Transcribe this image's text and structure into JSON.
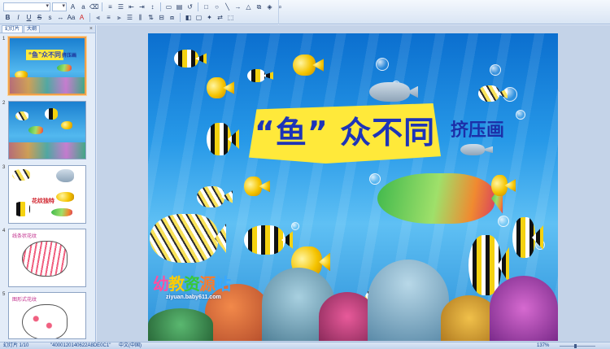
{
  "panel": {
    "tabs": [
      "幻灯片",
      "大纲"
    ],
    "close": "×",
    "slides": [
      {
        "number": "1",
        "title": "“鱼”众不同",
        "subtitle": "挤压画"
      },
      {
        "number": "2"
      },
      {
        "number": "3",
        "caption": "花纹独特"
      },
      {
        "number": "4",
        "label": "线条状花纹"
      },
      {
        "number": "5",
        "label": "图形式花纹"
      }
    ]
  },
  "slide": {
    "title": "“鱼” 众不同",
    "subtitle": "挤压画",
    "logo_text": [
      "幼",
      "教",
      "资",
      "源",
      "站"
    ],
    "logo_url": "ziyuan.baby611.com"
  },
  "statusbar": {
    "slide_info": "幻灯片 1/10",
    "theme": "\"4000120140622A8DE0C1\"",
    "language": "中文(中国)",
    "zoom": "137%",
    "zoom_level": 0.45
  },
  "colors": {
    "title_fill": "#ffe93a",
    "title_text": "#1d34b8",
    "ocean_top": "#0b6fcf",
    "selection": "#f0a04a"
  }
}
